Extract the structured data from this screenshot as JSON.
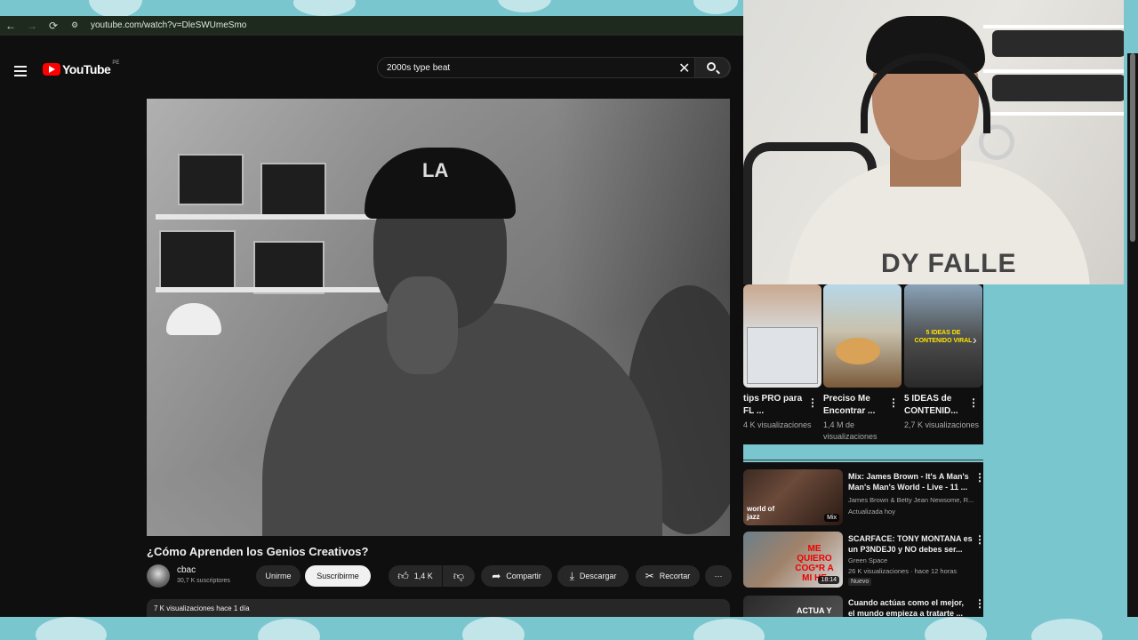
{
  "browser": {
    "url": "youtube.com/watch?v=DleSWUmeSmo",
    "back_icon": "←",
    "forward_icon": "→",
    "reload_icon": "⟳",
    "site_info_icon": "⚙"
  },
  "header": {
    "logo_text": "YouTube",
    "country_code": "PE",
    "search_query": "2000s type beat"
  },
  "video": {
    "title": "¿Cómo Aprenden los Genios Creativos?",
    "cap_text": "LA",
    "channel_name": "cbac",
    "subscribers": "30,7 K suscriptores",
    "join_label": "Unirme",
    "subscribe_label": "Suscribirme",
    "likes": "1,4 K",
    "share_label": "Compartir",
    "download_label": "Descargar",
    "clip_label": "Recortar",
    "more_label": "···",
    "views_date": "7 K visualizaciones  hace 1 día"
  },
  "webcam": {
    "shirt_text": "DY FALLE"
  },
  "shorts": [
    {
      "title": "tips PRO para FL ...",
      "views": "4 K visualizaciones"
    },
    {
      "title": "Preciso Me Encontrar ...",
      "views": "1,4 M de visualizaciones"
    },
    {
      "title": "5 IDEAS de CONTENID...",
      "views": "2,7 K visualizaciones",
      "overlay": "5 IDEAS DE CONTENIDO VIRAL"
    }
  ],
  "recommendations": [
    {
      "title": "Mix: James Brown - It's A Man's Man's Man's World - Live - 11 ...",
      "channel": "James Brown & Betty Jean Newsome, R...",
      "meta": "Actualizada hoy",
      "thumb_label": "world of jazz",
      "badge": "Mix"
    },
    {
      "title": "SCARFACE: TONY MONTANA es un P3NDEJ0 y NO debes ser...",
      "channel": "Green Space",
      "meta": "26 K visualizaciones · hace 12 horas",
      "badge_new": "Nuevo",
      "duration": "18:14",
      "thumb_label": "ME QUIERO COG*R A MI HE"
    },
    {
      "title": "Cuando actúas como el mejor, el mundo empieza a tratarte ...",
      "thumb_label": "ACTUA Y"
    }
  ],
  "colors": {
    "background": "#0f0f0f",
    "accent": "#ff0000",
    "page_bg": "#79c6cf"
  }
}
